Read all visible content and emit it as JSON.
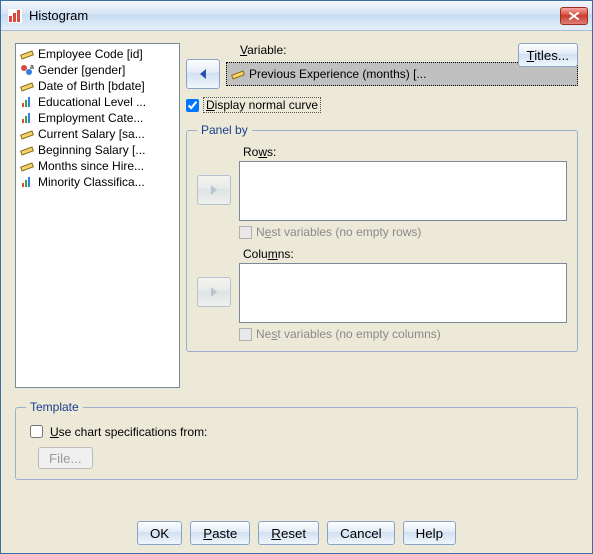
{
  "window": {
    "title": "Histogram",
    "close_tooltip": "Close"
  },
  "variable_list": [
    {
      "icon": "ruler",
      "label": "Employee Code [id]"
    },
    {
      "icon": "nominal",
      "label": "Gender [gender]"
    },
    {
      "icon": "ruler",
      "label": "Date of Birth [bdate]"
    },
    {
      "icon": "ordinal",
      "label": "Educational Level ..."
    },
    {
      "icon": "ordinal",
      "label": "Employment Cate..."
    },
    {
      "icon": "ruler",
      "label": "Current Salary [sa..."
    },
    {
      "icon": "ruler",
      "label": "Beginning Salary [..."
    },
    {
      "icon": "ruler",
      "label": "Months since Hire..."
    },
    {
      "icon": "ordinal",
      "label": "Minority Classifica..."
    }
  ],
  "variable_section": {
    "label": "Variable:",
    "selected": "Previous Experience (months) [..."
  },
  "titles_button": "Titles...",
  "display_curve": {
    "label": "Display normal curve",
    "checked": true
  },
  "panel_by": {
    "legend": "Panel by",
    "rows_label": "Rows:",
    "rows_nest": "Nest variables (no empty rows)",
    "cols_label": "Columns:",
    "cols_nest": "Nest variables (no empty columns)"
  },
  "template": {
    "legend": "Template",
    "use_label": "Use chart specifications from:",
    "file_button": "File..."
  },
  "buttons": {
    "ok": "OK",
    "paste": "Paste",
    "reset": "Reset",
    "cancel": "Cancel",
    "help": "Help"
  }
}
